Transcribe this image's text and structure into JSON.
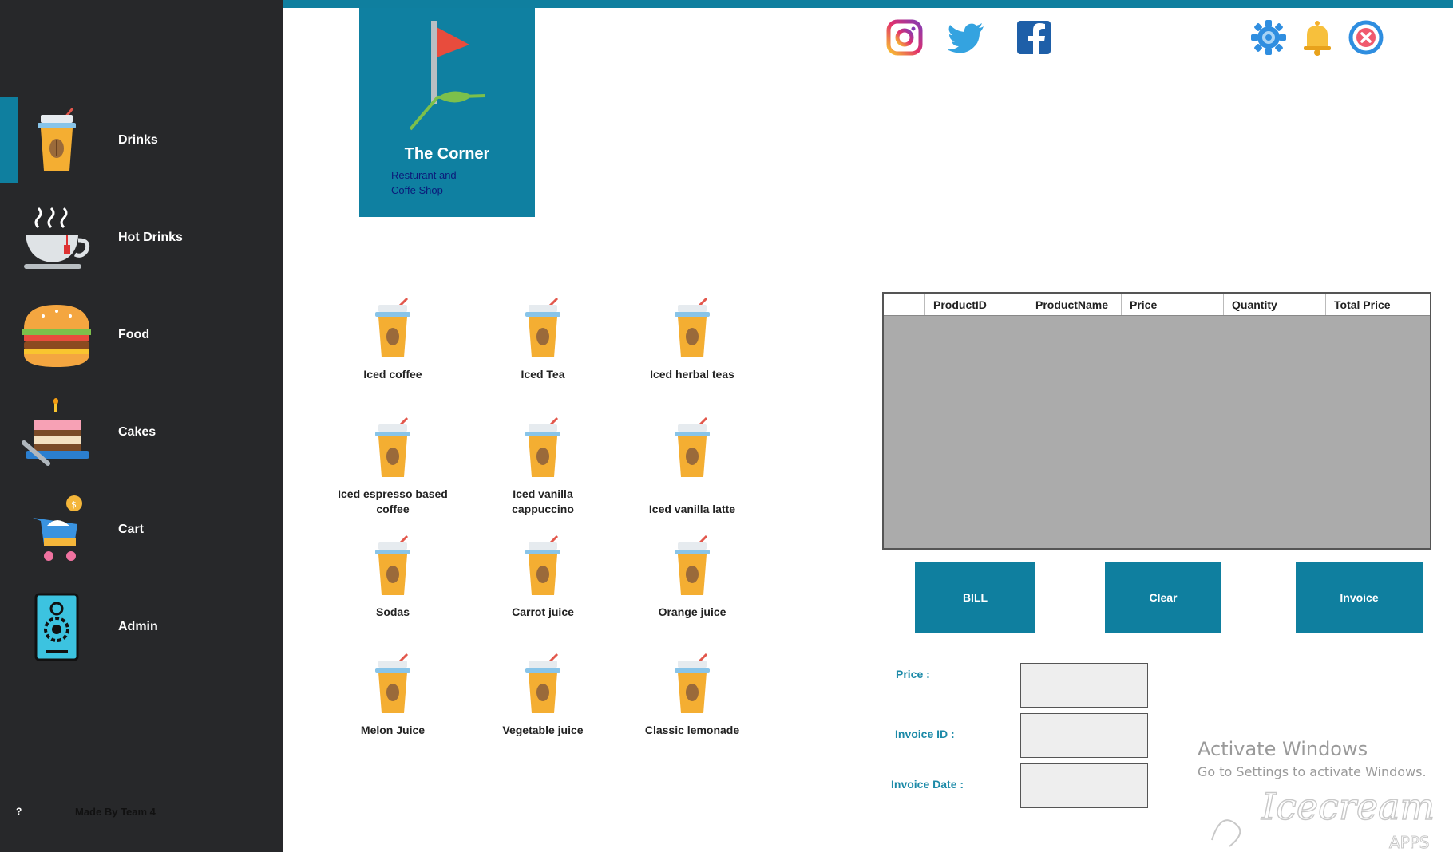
{
  "sidebar": {
    "items": [
      {
        "label": "Drinks",
        "icon": "drink-cup-icon"
      },
      {
        "label": "Hot Drinks",
        "icon": "hot-tea-cup-icon"
      },
      {
        "label": "Food",
        "icon": "burger-icon"
      },
      {
        "label": "Cakes",
        "icon": "cake-icon"
      },
      {
        "label": "Cart",
        "icon": "cart-icon"
      },
      {
        "label": "Admin",
        "icon": "admin-badge-icon"
      }
    ],
    "footer_help": "?",
    "footer_credit": "Made By Team 4"
  },
  "brand": {
    "title": "The Corner",
    "subtitle_line1": "Resturant and",
    "subtitle_line2": "Coffe Shop"
  },
  "social": [
    "instagram-icon",
    "twitter-icon",
    "facebook-icon"
  ],
  "top_actions": [
    "settings-gear-icon",
    "notification-bell-icon",
    "close-icon"
  ],
  "products": [
    {
      "line1": "Iced coffee",
      "line2": ""
    },
    {
      "line1": "Iced Tea",
      "line2": ""
    },
    {
      "line1": "Iced herbal teas",
      "line2": ""
    },
    {
      "line1": "Iced espresso based",
      "line2": "coffee"
    },
    {
      "line1": "Iced vanilla",
      "line2": "cappuccino"
    },
    {
      "line1": "Iced vanilla latte",
      "line2": ""
    },
    {
      "line1": "Sodas",
      "line2": ""
    },
    {
      "line1": "Carrot juice",
      "line2": ""
    },
    {
      "line1": "Orange juice",
      "line2": ""
    },
    {
      "line1": "Melon Juice",
      "line2": ""
    },
    {
      "line1": "Vegetable juice",
      "line2": ""
    },
    {
      "line1": "Classic lemonade",
      "line2": ""
    }
  ],
  "table": {
    "columns": [
      "ProductID",
      "ProductName",
      "Price",
      "Quantity",
      "Total Price"
    ],
    "rows": []
  },
  "actions": {
    "bill": "BILL",
    "clear": "Clear",
    "invoice": "Invoice"
  },
  "form": {
    "price_label": "Price :",
    "price_value": "",
    "invoice_id_label": "Invoice ID :",
    "invoice_id_value": "",
    "invoice_date_label": "Invoice Date :",
    "invoice_date_value": ""
  },
  "watermark": {
    "activate_title": "Activate Windows",
    "activate_sub": "Go to Settings to activate Windows.",
    "brand_mark": "Icecream",
    "brand_mark_sub": "APPS"
  },
  "colors": {
    "accent": "#0f7f9f",
    "sidebar_bg": "#27282a",
    "grid_bg": "#ababab"
  }
}
